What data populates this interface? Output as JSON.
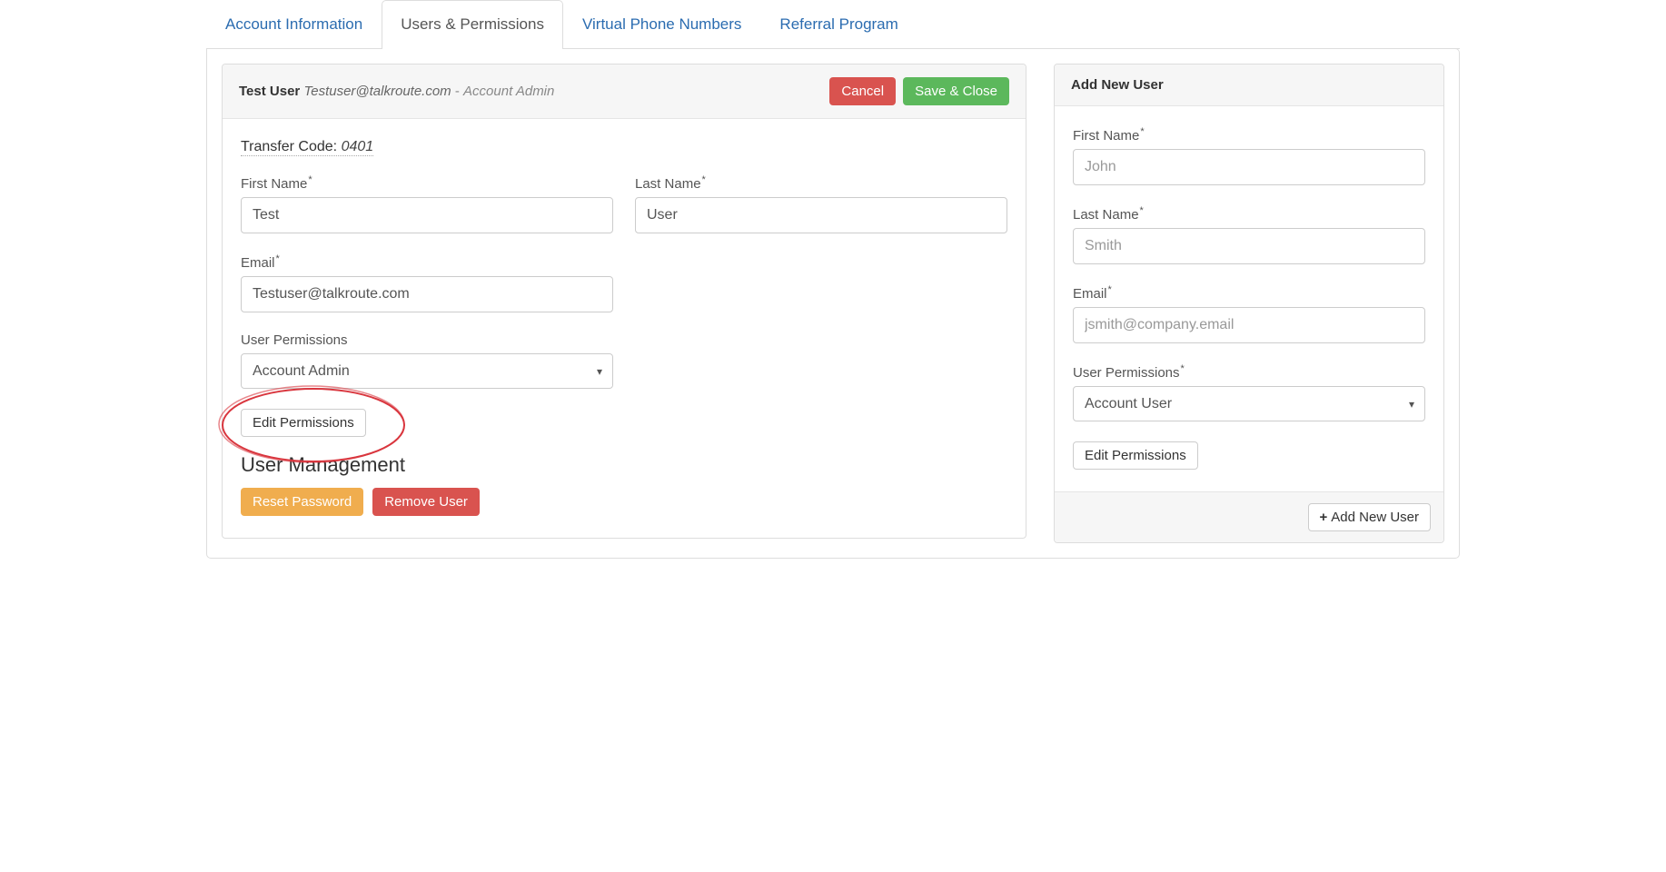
{
  "tabs": {
    "account_info": "Account Information",
    "users_permissions": "Users & Permissions",
    "virtual_numbers": "Virtual Phone Numbers",
    "referral": "Referral Program"
  },
  "editUser": {
    "header": {
      "name": "Test User",
      "email": "Testuser@talkroute.com",
      "separator": " - ",
      "role": "Account Admin",
      "cancel": "Cancel",
      "save": "Save & Close"
    },
    "transfer": {
      "label": "Transfer Code: ",
      "code": "0401"
    },
    "labels": {
      "first_name": "First Name",
      "last_name": "Last Name",
      "email": "Email",
      "user_permissions": "User Permissions"
    },
    "values": {
      "first_name": "Test",
      "last_name": "User",
      "email": "Testuser@talkroute.com",
      "user_permissions": "Account Admin"
    },
    "edit_permissions": "Edit Permissions",
    "user_management_title": "User Management",
    "reset_password": "Reset Password",
    "remove_user": "Remove User"
  },
  "addUser": {
    "title": "Add New User",
    "labels": {
      "first_name": "First Name",
      "last_name": "Last Name",
      "email": "Email",
      "user_permissions": "User Permissions"
    },
    "placeholders": {
      "first_name": "John",
      "last_name": "Smith",
      "email": "jsmith@company.email"
    },
    "values": {
      "user_permissions": "Account User"
    },
    "edit_permissions": "Edit Permissions",
    "add_button": "Add New User"
  }
}
